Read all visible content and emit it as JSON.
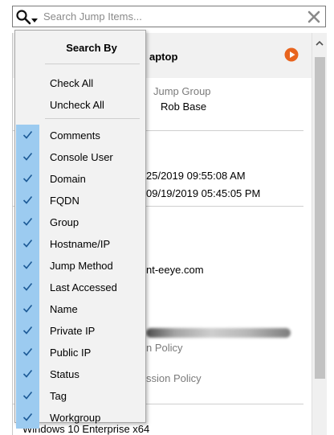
{
  "search": {
    "placeholder": "Search Jump Items..."
  },
  "detail": {
    "title_fragment": "aptop",
    "jump_group_label": "Jump Group",
    "jump_group_value": "Rob Base",
    "date_1": "25/2019 09:55:08 AM",
    "date_2": "09/19/2019 05:45:05 PM",
    "hostname_fragment": "nt-eeye.com",
    "policy_label_1": "n Policy",
    "policy_label_2": "ssion Policy",
    "os_text": "Windows 10 Enterprise x64"
  },
  "menu": {
    "heading": "Search By",
    "check_all": "Check All",
    "uncheck_all": "Uncheck All",
    "items": [
      {
        "label": "Comments",
        "checked": true
      },
      {
        "label": "Console User",
        "checked": true
      },
      {
        "label": "Domain",
        "checked": true
      },
      {
        "label": "FQDN",
        "checked": true
      },
      {
        "label": "Group",
        "checked": true
      },
      {
        "label": "Hostname/IP",
        "checked": true
      },
      {
        "label": "Jump Method",
        "checked": true
      },
      {
        "label": "Last Accessed",
        "checked": true
      },
      {
        "label": "Name",
        "checked": true
      },
      {
        "label": "Private IP",
        "checked": true
      },
      {
        "label": "Public IP",
        "checked": true
      },
      {
        "label": "Status",
        "checked": true
      },
      {
        "label": "Tag",
        "checked": true
      },
      {
        "label": "Workgroup",
        "checked": true
      }
    ]
  },
  "colors": {
    "check_highlight": "#9ccbf0",
    "check_mark": "#1c5a96",
    "play_button": "#e8641e"
  },
  "icons": [
    "search-icon",
    "clear-icon",
    "play-icon",
    "scroll-up-icon",
    "check-icon"
  ]
}
